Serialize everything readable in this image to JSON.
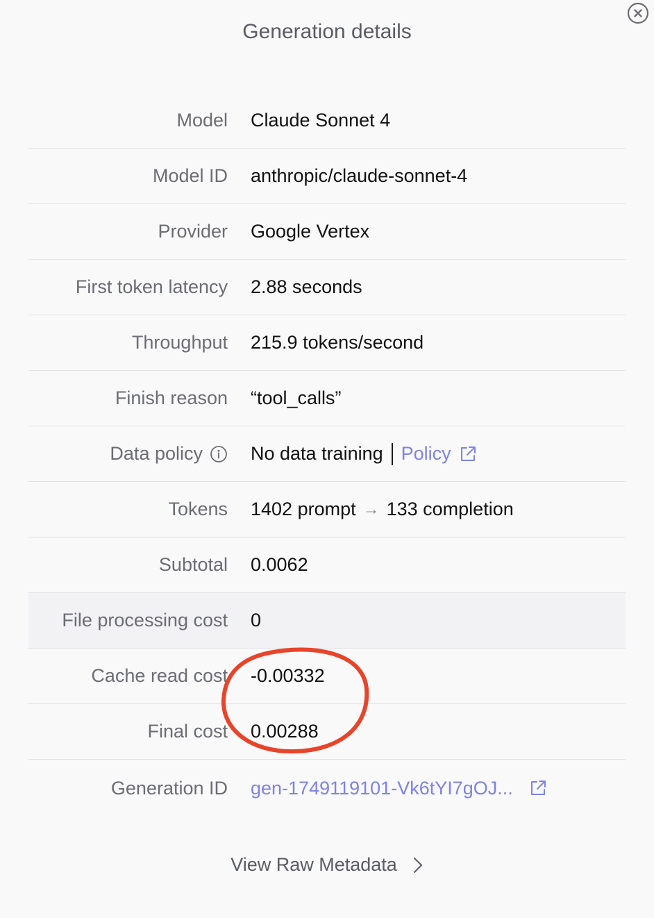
{
  "title": "Generation details",
  "close_icon": "close-circle-icon",
  "rows": [
    {
      "label": "Model",
      "value": "Claude Sonnet 4"
    },
    {
      "label": "Model ID",
      "value": "anthropic/claude-sonnet-4"
    },
    {
      "label": "Provider",
      "value": "Google Vertex"
    },
    {
      "label": "First token latency",
      "value": "2.88 seconds"
    },
    {
      "label": "Throughput",
      "value": "215.9 tokens/second"
    },
    {
      "label": "Finish reason",
      "value": "“tool_calls”"
    },
    {
      "label": "Data policy",
      "value": "No data training",
      "link": "Policy",
      "icon": "info-icon"
    },
    {
      "label": "Tokens",
      "prompt": "1402 prompt",
      "arrow": "→",
      "completion": "133 completion"
    },
    {
      "label": "Subtotal",
      "value": "0.0062"
    },
    {
      "label": "File processing cost",
      "value": "0"
    },
    {
      "label": "Cache read cost",
      "value": "-0.00332"
    },
    {
      "label": "Final cost",
      "value": "0.00288"
    },
    {
      "label": "Generation ID",
      "value": "gen-1749119101-Vk6tYI7gOJ..."
    }
  ],
  "raw_metadata_label": "View Raw Metadata",
  "colors": {
    "link": "#7d83e8",
    "annotation": "#e8442a",
    "highlight_row": "#f2f2f4"
  }
}
